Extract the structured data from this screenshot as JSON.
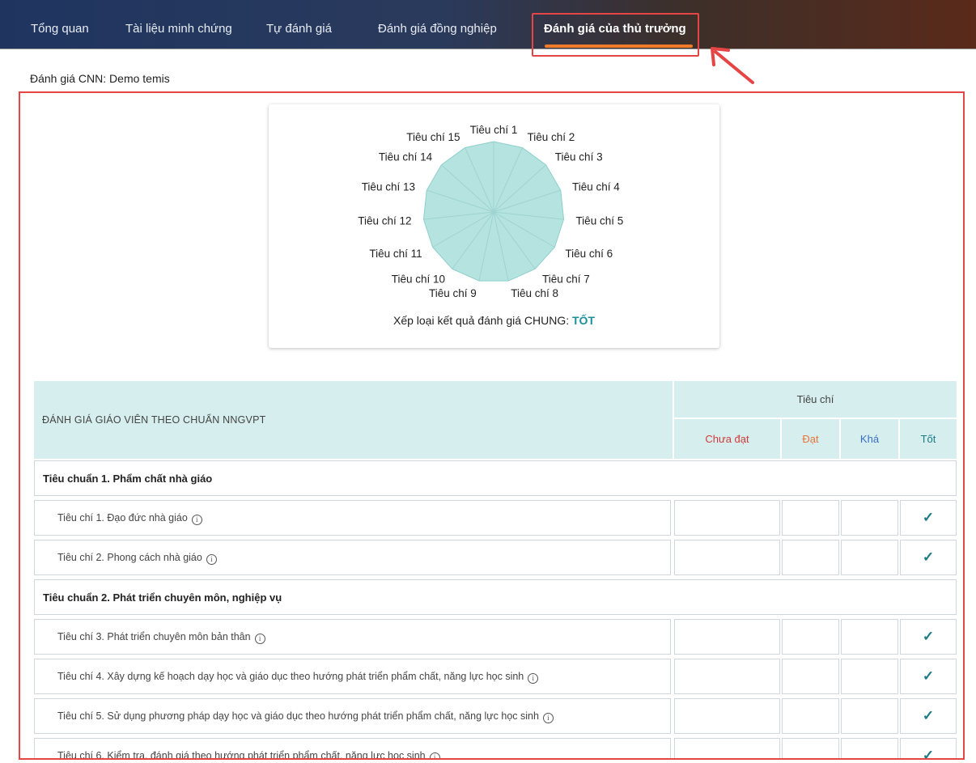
{
  "nav": {
    "tabs": [
      {
        "label": "Tổng quan"
      },
      {
        "label": "Tài liệu minh chứng"
      },
      {
        "label": "Tự đánh giá"
      },
      {
        "label": "Đánh giá đồng nghiệp"
      },
      {
        "label": "Đánh giá của thủ trưởng",
        "active": true
      }
    ]
  },
  "subtitle": "Đánh giá CNN: Demo temis",
  "chart_data": {
    "type": "radar",
    "categories": [
      "Tiêu chí 1",
      "Tiêu chí 2",
      "Tiêu chí 3",
      "Tiêu chí 4",
      "Tiêu chí 5",
      "Tiêu chí 6",
      "Tiêu chí 7",
      "Tiêu chí 8",
      "Tiêu chí 9",
      "Tiêu chí 10",
      "Tiêu chí 11",
      "Tiêu chí 12",
      "Tiêu chí 13",
      "Tiêu chí 14",
      "Tiêu chí 15"
    ],
    "values": [
      4,
      4,
      4,
      4,
      4,
      4,
      4,
      4,
      4,
      4,
      4,
      4,
      4,
      4,
      4
    ],
    "scale_max": 4,
    "fill_color": "#b5e3e0",
    "line_color": "#8ccfcb"
  },
  "chart_caption": {
    "prefix": "Xếp loại kết quả đánh giá CHUNG: ",
    "result": "TỐT"
  },
  "table": {
    "title": "ĐÁNH GIÁ GIÁO VIÊN THEO CHUẨN NNGVPT",
    "group_header": "Tiêu chí",
    "columns": [
      {
        "label": "Chưa đạt",
        "color": "#d23b3b"
      },
      {
        "label": "Đạt",
        "color": "#e8743a"
      },
      {
        "label": "Khá",
        "color": "#3a6ec0"
      },
      {
        "label": "Tốt",
        "color": "#1c7a82"
      }
    ],
    "rows": [
      {
        "kind": "standard",
        "label": "Tiêu chuẩn 1. Phẩm chất nhà giáo"
      },
      {
        "kind": "criterion",
        "label": "Tiêu chí 1. Đạo đức nhà giáo",
        "rating": "Tốt"
      },
      {
        "kind": "criterion",
        "label": "Tiêu chí 2. Phong cách nhà giáo",
        "rating": "Tốt"
      },
      {
        "kind": "standard",
        "label": "Tiêu chuẩn 2. Phát triển chuyên môn, nghiệp vụ"
      },
      {
        "kind": "criterion",
        "label": "Tiêu chí 3. Phát triển chuyên môn bản thân",
        "rating": "Tốt"
      },
      {
        "kind": "criterion",
        "label": "Tiêu chí 4. Xây dựng kế hoạch dạy học và giáo dục theo hướng phát triển phẩm chất, năng lực học sinh",
        "rating": "Tốt"
      },
      {
        "kind": "criterion",
        "label": "Tiêu chí 5. Sử dụng phương pháp dạy học và giáo dục theo hướng phát triển phẩm chất, năng lực học sinh",
        "rating": "Tốt"
      },
      {
        "kind": "criterion",
        "label": "Tiêu chí 6. Kiểm tra, đánh giá theo hướng phát triển phẩm chất, năng lực học sinh",
        "rating": "Tốt"
      }
    ]
  },
  "icons": {
    "info": "info-circle-icon",
    "check": "checkmark-icon",
    "arrow": "annotation-arrow-icon"
  }
}
